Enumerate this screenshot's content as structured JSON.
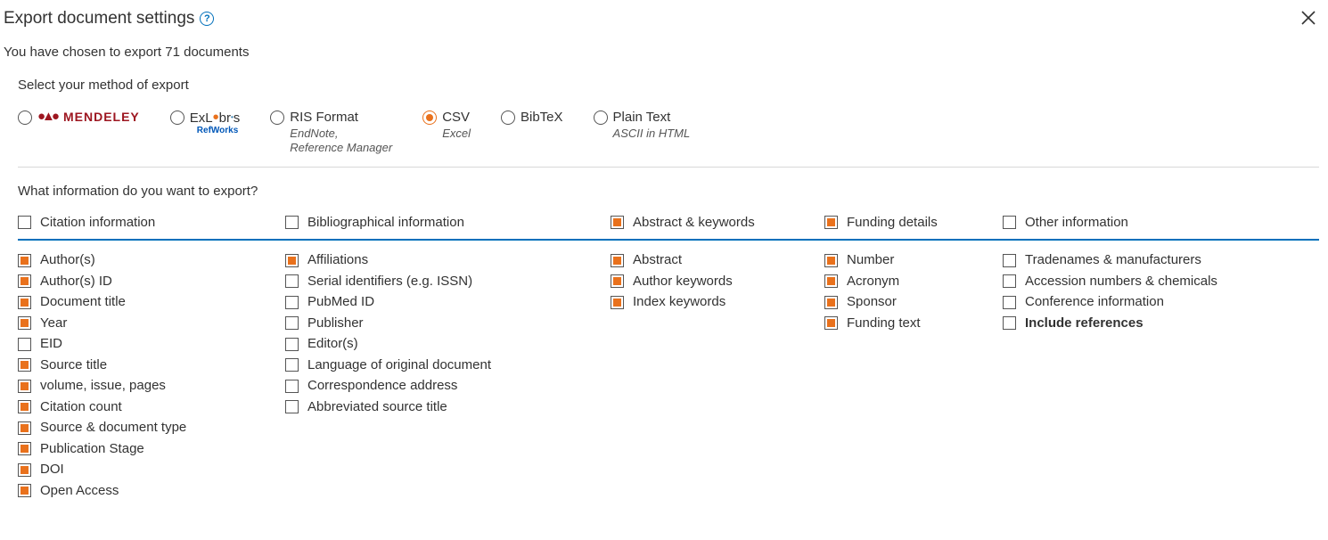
{
  "header": {
    "title": "Export document settings",
    "subtext": "You have chosen to export 71 documents"
  },
  "export_method": {
    "label": "Select your method of export",
    "options": {
      "mendeley": {
        "word": "MENDELEY"
      },
      "exlibris": {
        "top": "ExLibris",
        "bot": "RefWorks"
      },
      "ris": {
        "main": "RIS Format",
        "sub": "EndNote,\nReference Manager"
      },
      "csv": {
        "main": "CSV",
        "sub": "Excel"
      },
      "bibtex": {
        "main": "BibTeX"
      },
      "plain": {
        "main": "Plain Text",
        "sub": "ASCII in HTML"
      }
    },
    "selected": "csv"
  },
  "info_label": "What information do you want to export?",
  "columns": {
    "citation": {
      "header": "Citation information",
      "header_checked": false,
      "items": [
        {
          "label": "Author(s)",
          "checked": true
        },
        {
          "label": "Author(s) ID",
          "checked": true
        },
        {
          "label": "Document title",
          "checked": true
        },
        {
          "label": "Year",
          "checked": true
        },
        {
          "label": "EID",
          "checked": false
        },
        {
          "label": "Source title",
          "checked": true
        },
        {
          "label": "volume, issue, pages",
          "checked": true
        },
        {
          "label": "Citation count",
          "checked": true
        },
        {
          "label": "Source & document type",
          "checked": true
        },
        {
          "label": "Publication Stage",
          "checked": true
        },
        {
          "label": "DOI",
          "checked": true
        },
        {
          "label": "Open Access",
          "checked": true
        }
      ]
    },
    "biblio": {
      "header": "Bibliographical information",
      "header_checked": false,
      "items": [
        {
          "label": "Affiliations",
          "checked": true
        },
        {
          "label": "Serial identifiers (e.g. ISSN)",
          "checked": false
        },
        {
          "label": "PubMed ID",
          "checked": false
        },
        {
          "label": "Publisher",
          "checked": false
        },
        {
          "label": "Editor(s)",
          "checked": false
        },
        {
          "label": "Language of original document",
          "checked": false
        },
        {
          "label": "Correspondence address",
          "checked": false
        },
        {
          "label": "Abbreviated source title",
          "checked": false
        }
      ]
    },
    "abstract": {
      "header": "Abstract & keywords",
      "header_checked": true,
      "items": [
        {
          "label": "Abstract",
          "checked": true
        },
        {
          "label": "Author keywords",
          "checked": true
        },
        {
          "label": "Index keywords",
          "checked": true
        }
      ]
    },
    "funding": {
      "header": "Funding details",
      "header_checked": true,
      "items": [
        {
          "label": "Number",
          "checked": true
        },
        {
          "label": "Acronym",
          "checked": true
        },
        {
          "label": "Sponsor",
          "checked": true
        },
        {
          "label": "Funding text",
          "checked": true
        }
      ]
    },
    "other": {
      "header": "Other information",
      "header_checked": false,
      "items": [
        {
          "label": "Tradenames & manufacturers",
          "checked": false
        },
        {
          "label": "Accession numbers & chemicals",
          "checked": false
        },
        {
          "label": "Conference information",
          "checked": false
        },
        {
          "label": "Include references",
          "checked": false,
          "bold": true
        }
      ]
    }
  }
}
